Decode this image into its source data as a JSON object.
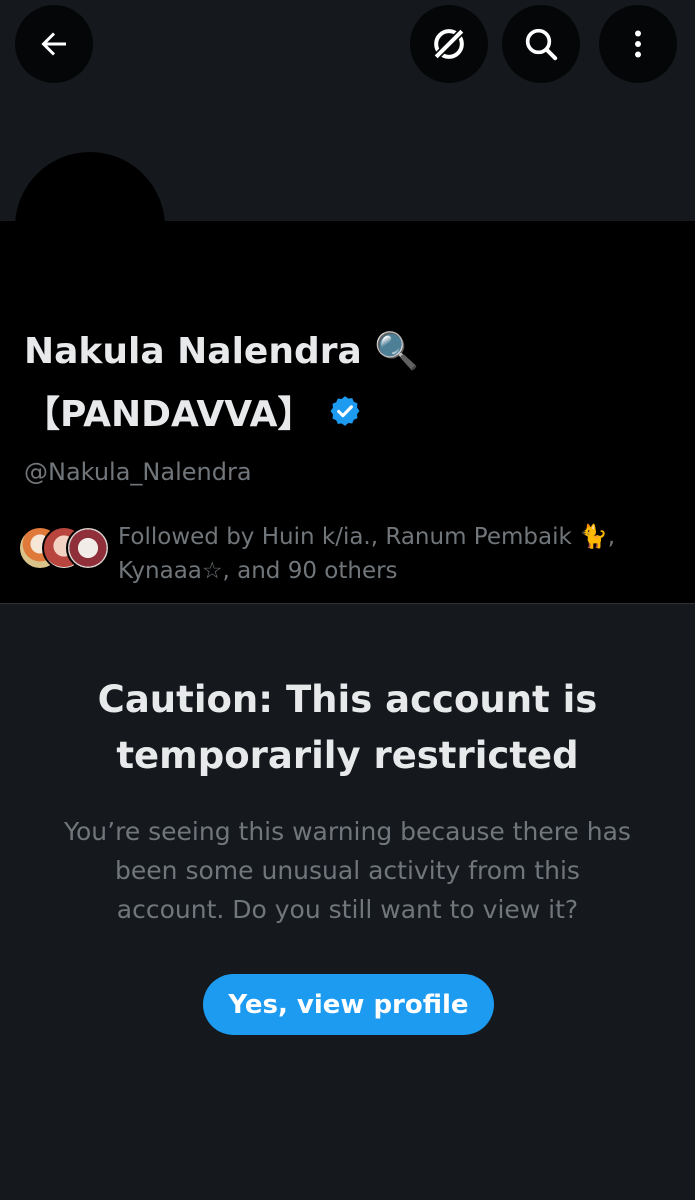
{
  "colors": {
    "background": "#15181c",
    "profile_bg": "#000000",
    "accent": "#1d9bf0",
    "text_primary": "#e7e9ea",
    "text_secondary": "#71767b"
  },
  "header": {
    "back_icon": "arrow-left-icon",
    "grok_icon": "grok-icon",
    "search_icon": "search-icon",
    "more_icon": "more-vertical-icon"
  },
  "profile": {
    "display_name_line1": "Nakula Nalendra 🔍",
    "display_name_line2": "【PANDAVVA】",
    "verified_icon": "verified-badge-icon",
    "handle": "@Nakula_Nalendra",
    "followed_by": "Followed by Huin k/ia., Ranum Pembaik 🐈, Kynaaa☆, and 90 others"
  },
  "restriction": {
    "title": "Caution: This account is temporarily restricted",
    "body": "You’re seeing this warning because there has been some unusual activity from this account. Do you still want to view it?",
    "button_label": "Yes, view profile"
  }
}
